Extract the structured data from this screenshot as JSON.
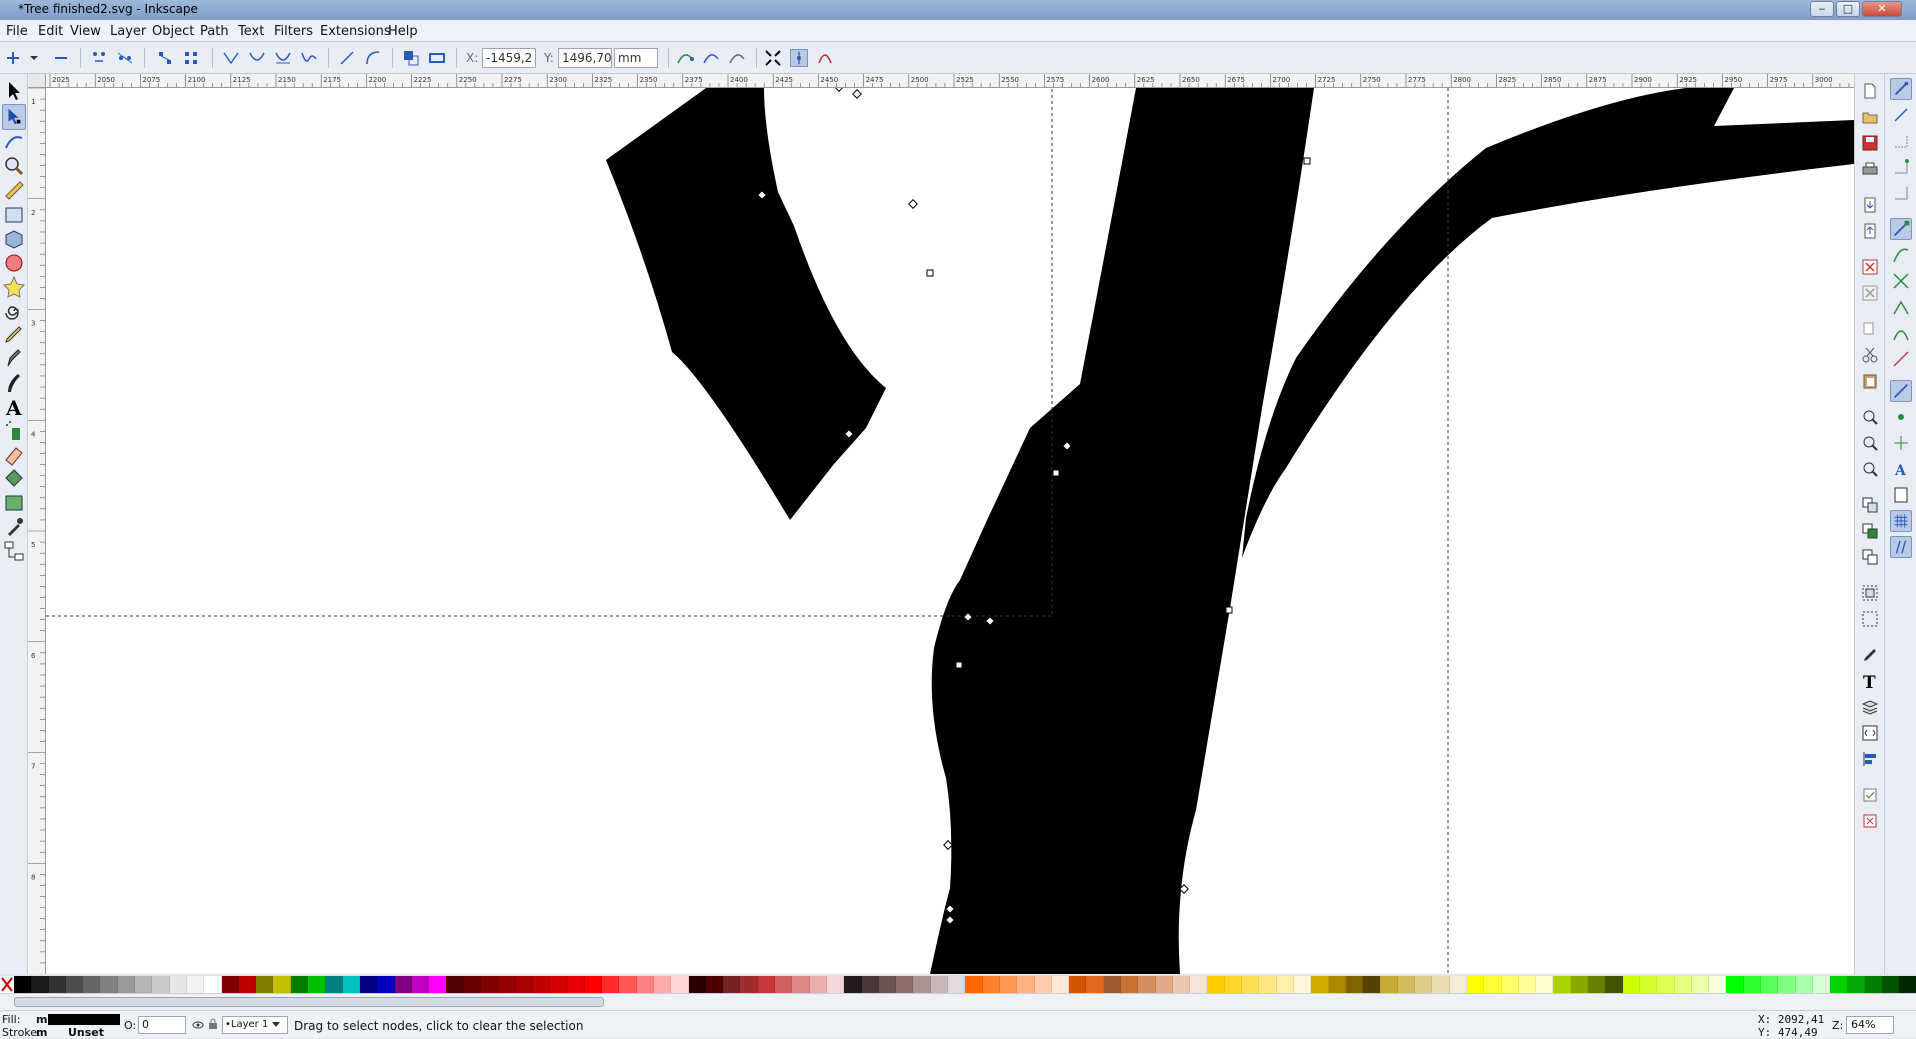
{
  "window": {
    "title": "*Tree finished2.svg - Inkscape",
    "min": "‒",
    "max": "□",
    "close": "✕"
  },
  "menu": [
    "File",
    "Edit",
    "View",
    "Layer",
    "Object",
    "Path",
    "Text",
    "Filters",
    "Extensions",
    "Help"
  ],
  "toolctrl": {
    "x_label": "X:",
    "x_value": "-1459,2",
    "y_label": "Y:",
    "y_value": "1496,70",
    "unit": "mm"
  },
  "ruler": {
    "h_labels": [
      "2025",
      "2050",
      "2075",
      "2100",
      "2125",
      "2150",
      "2175",
      "2200",
      "2225",
      "2250",
      "2275",
      "2300",
      "2325",
      "2350",
      "2375",
      "2400",
      "2425",
      "2450",
      "2475",
      "2500",
      "2525",
      "2550",
      "2575",
      "2600",
      "2625",
      "2650",
      "2675",
      "2700",
      "2725",
      "2750",
      "2775",
      "2800",
      "2825",
      "2850",
      "2875",
      "2900",
      "2925",
      "2950",
      "2975",
      "3000"
    ],
    "v_labels": [
      "1",
      "2",
      "3",
      "4",
      "5",
      "6",
      "7",
      "8"
    ]
  },
  "palette": [
    "#000000",
    "#1a1a1a",
    "#333333",
    "#4d4d4d",
    "#666666",
    "#808080",
    "#999999",
    "#b3b3b3",
    "#cccccc",
    "#e6e6e6",
    "#f2f2f2",
    "#ffffff",
    "#800000",
    "#c00000",
    "#808000",
    "#c0c000",
    "#008000",
    "#00c000",
    "#008080",
    "#00c0c0",
    "#000080",
    "#0000c0",
    "#800080",
    "#c000c0",
    "#ff00ff",
    "#550000",
    "#6b0000",
    "#800000",
    "#950000",
    "#aa0000",
    "#c00000",
    "#d40000",
    "#ea0000",
    "#ff0000",
    "#ff2a2a",
    "#ff5555",
    "#ff8080",
    "#ffaaaa",
    "#ffd5d5",
    "#2b0000",
    "#500000",
    "#782121",
    "#a02c2c",
    "#c83737",
    "#d35f5f",
    "#de8787",
    "#e9afaf",
    "#f4d7d7",
    "#241c1c",
    "#483737",
    "#6c5353",
    "#916f6f",
    "#ac9393",
    "#c8b7b7",
    "#e3dbdb",
    "#ff6600",
    "#ff7f2a",
    "#ff9955",
    "#ffb380",
    "#ffccaa",
    "#ffe6d5",
    "#d45500",
    "#e06a1a",
    "#a05a2c",
    "#c87137",
    "#d38d5f",
    "#deaa87",
    "#e9c6af",
    "#f4e3d7",
    "#ffcc00",
    "#ffd42a",
    "#ffdd55",
    "#ffe680",
    "#ffeeaa",
    "#fff6d5",
    "#d4aa00",
    "#aa8800",
    "#806600",
    "#554400",
    "#c8ab37",
    "#d4bb5f",
    "#decd87",
    "#e9ddaf",
    "#f4eed7",
    "#ffff00",
    "#ffff33",
    "#ffff66",
    "#ffff99",
    "#ffffcc",
    "#aad400",
    "#88aa00",
    "#668000",
    "#445500",
    "#ccff00",
    "#d4ff2a",
    "#ddff55",
    "#e5ff80",
    "#eeffaa",
    "#f6ffd5",
    "#00ff00",
    "#2aff2a",
    "#55ff55",
    "#80ff80",
    "#aaffaa",
    "#d5ffd5",
    "#00d400",
    "#00aa00",
    "#008000",
    "#005500",
    "#002b00"
  ],
  "status": {
    "fill_label": "Fill:",
    "fill_value": "m",
    "stroke_label": "Stroke:",
    "stroke_value": "m",
    "stroke_unset": "Unset",
    "opacity_label": "O:",
    "opacity_value": "0",
    "layer": "•Layer 1",
    "message": "Drag to select nodes, click to clear the selection",
    "x_coord": "X: 2092,41",
    "y_coord": "Y: 474,49",
    "zoom_label": "Z:",
    "zoom_value": "64%"
  }
}
